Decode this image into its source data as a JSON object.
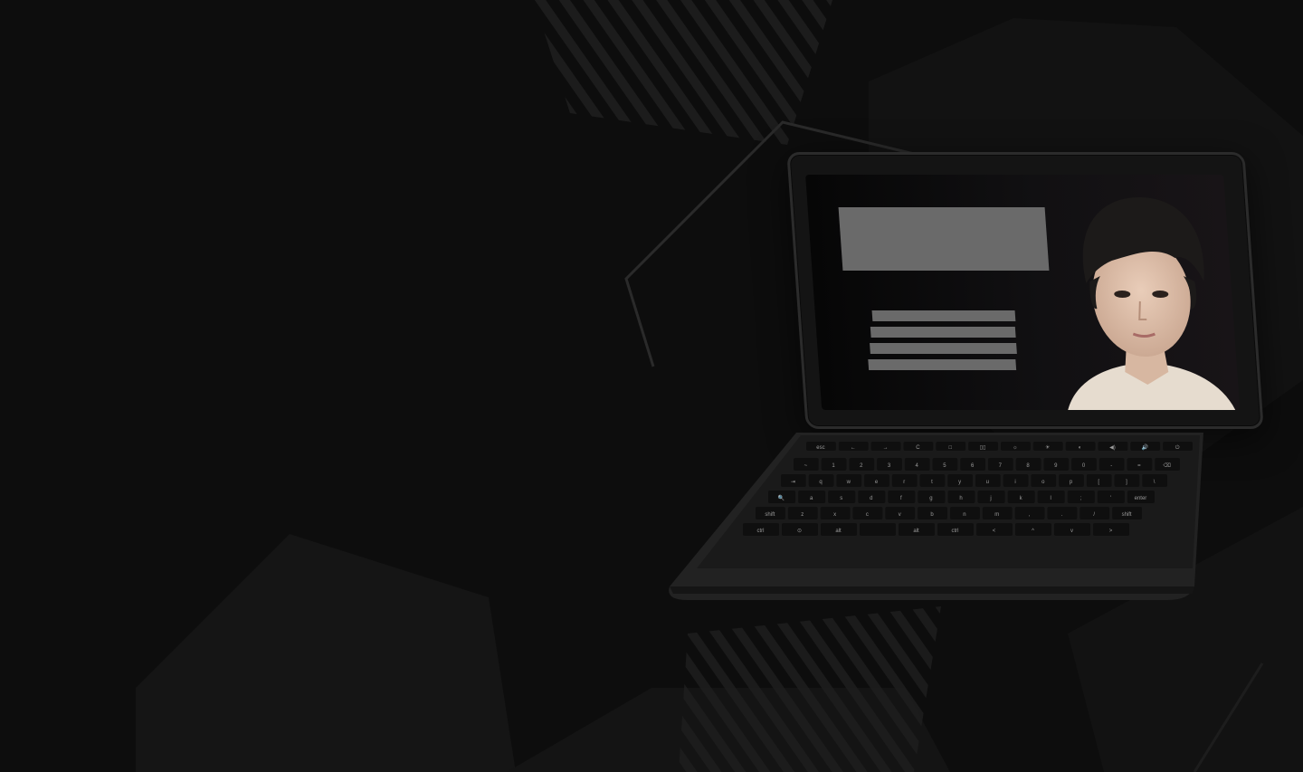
{
  "scene": {
    "description_text": "",
    "background_color": "#0d0d0d",
    "accent_stroke": "#2a2a2a"
  },
  "laptop": {
    "keyboard_rows": [
      [
        "esc",
        "←",
        "→",
        "C",
        "□",
        "▯▯",
        "☼",
        "☀",
        "◐",
        "◀)",
        "🔊",
        "⏻"
      ],
      [
        "~",
        "1",
        "2",
        "3",
        "4",
        "5",
        "6",
        "7",
        "8",
        "9",
        "0",
        "-",
        "=",
        "⌫"
      ],
      [
        "⇥",
        "q",
        "w",
        "e",
        "r",
        "t",
        "y",
        "u",
        "i",
        "o",
        "p",
        "[",
        "]",
        "\\"
      ],
      [
        "🔍",
        "a",
        "s",
        "d",
        "f",
        "g",
        "h",
        "j",
        "k",
        "l",
        ";",
        "'",
        "enter"
      ],
      [
        "shift",
        "z",
        "x",
        "c",
        "v",
        "b",
        "n",
        "m",
        ",",
        ".",
        "/",
        "shift"
      ],
      [
        "ctrl",
        "⊙",
        "alt",
        "",
        "alt",
        "ctrl",
        "<",
        "^",
        "v",
        ">"
      ]
    ],
    "screen": {
      "placeholder_lines": 4
    }
  }
}
